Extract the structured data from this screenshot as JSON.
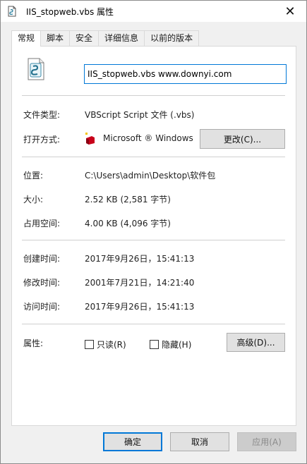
{
  "window": {
    "title": "IIS_stopweb.vbs 属性",
    "close_glyph": "✕"
  },
  "tabs": [
    {
      "label": "常规",
      "active": true
    },
    {
      "label": "脚本",
      "active": false
    },
    {
      "label": "安全",
      "active": false
    },
    {
      "label": "详细信息",
      "active": false
    },
    {
      "label": "以前的版本",
      "active": false
    }
  ],
  "general": {
    "file_name": "IIS_stopweb.vbs www.downyi.com",
    "file_type_label": "文件类型:",
    "file_type_value": "VBScript Script 文件 (.vbs)",
    "open_with_label": "打开方式:",
    "open_with_value": "Microsoft ® Windows",
    "change_button": "更改(C)...",
    "location_label": "位置:",
    "location_value": "C:\\Users\\admin\\Desktop\\软件包",
    "size_label": "大小:",
    "size_value": "2.52 KB (2,581 字节)",
    "size_on_disk_label": "占用空间:",
    "size_on_disk_value": "4.00 KB (4,096 字节)",
    "created_label": "创建时间:",
    "created_value": "2017年9月26日，15:41:13",
    "modified_label": "修改时间:",
    "modified_value": "2001年7月21日，14:21:40",
    "accessed_label": "访问时间:",
    "accessed_value": "2017年9月26日，15:41:13",
    "attributes_label": "属性:",
    "readonly_label": "只读(R)",
    "hidden_label": "隐藏(H)",
    "advanced_button": "高级(D)..."
  },
  "footer": {
    "ok": "确定",
    "cancel": "取消",
    "apply": "应用(A)"
  },
  "colors": {
    "accent": "#0078d7",
    "panel_bg": "#ffffff",
    "window_bg": "#f0f0f0"
  }
}
